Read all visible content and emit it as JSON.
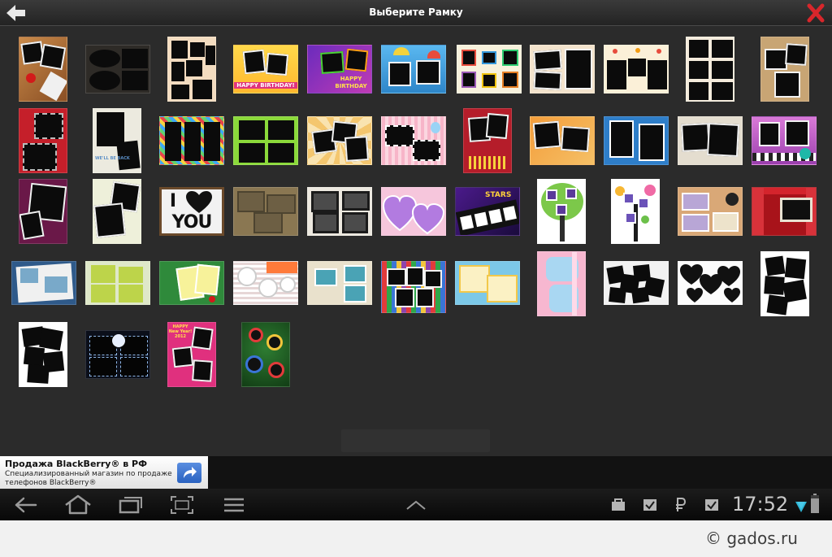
{
  "header": {
    "title": "Выберите Рамку",
    "back_icon": "arrow-left-icon",
    "close_icon": "close-x-icon",
    "close_color": "#d8262b"
  },
  "frames": {
    "row1": {
      "f4_caption": "HAPPY BIRTHDAY!",
      "f5_caption_1": "HAPPY",
      "f5_caption_2": "BIRTHDAY"
    },
    "row3": {
      "f3_caption_1": "I",
      "f3_caption_2": "YOU",
      "f3_heart_icon": "heart-icon",
      "f7_caption": "STARS"
    },
    "row2": {
      "f2_caption": "WE'LL BE BACK"
    },
    "row5": {
      "f3_caption_1": "HAPPY",
      "f3_caption_2": "New Year!",
      "f3_caption_3": "2012"
    }
  },
  "ad": {
    "title": "Продажа BlackBerry® в РФ",
    "text": "Специализированный магазин по продаже телефонов BlackBerry®",
    "arrow_icon": "share-arrow-icon"
  },
  "navbar": {
    "back_icon": "back-icon",
    "home_icon": "home-icon",
    "recents_icon": "recent-apps-icon",
    "screenshot_icon": "screenshot-icon",
    "menu_icon": "menu-icon",
    "up_icon": "chevron-up-icon"
  },
  "status": {
    "time": "17:52",
    "icons": [
      "bag-icon",
      "task-check-icon",
      "rouble-icon",
      "task-check-icon",
      "wifi-icon",
      "battery-icon"
    ]
  },
  "watermark": "© gados.ru"
}
